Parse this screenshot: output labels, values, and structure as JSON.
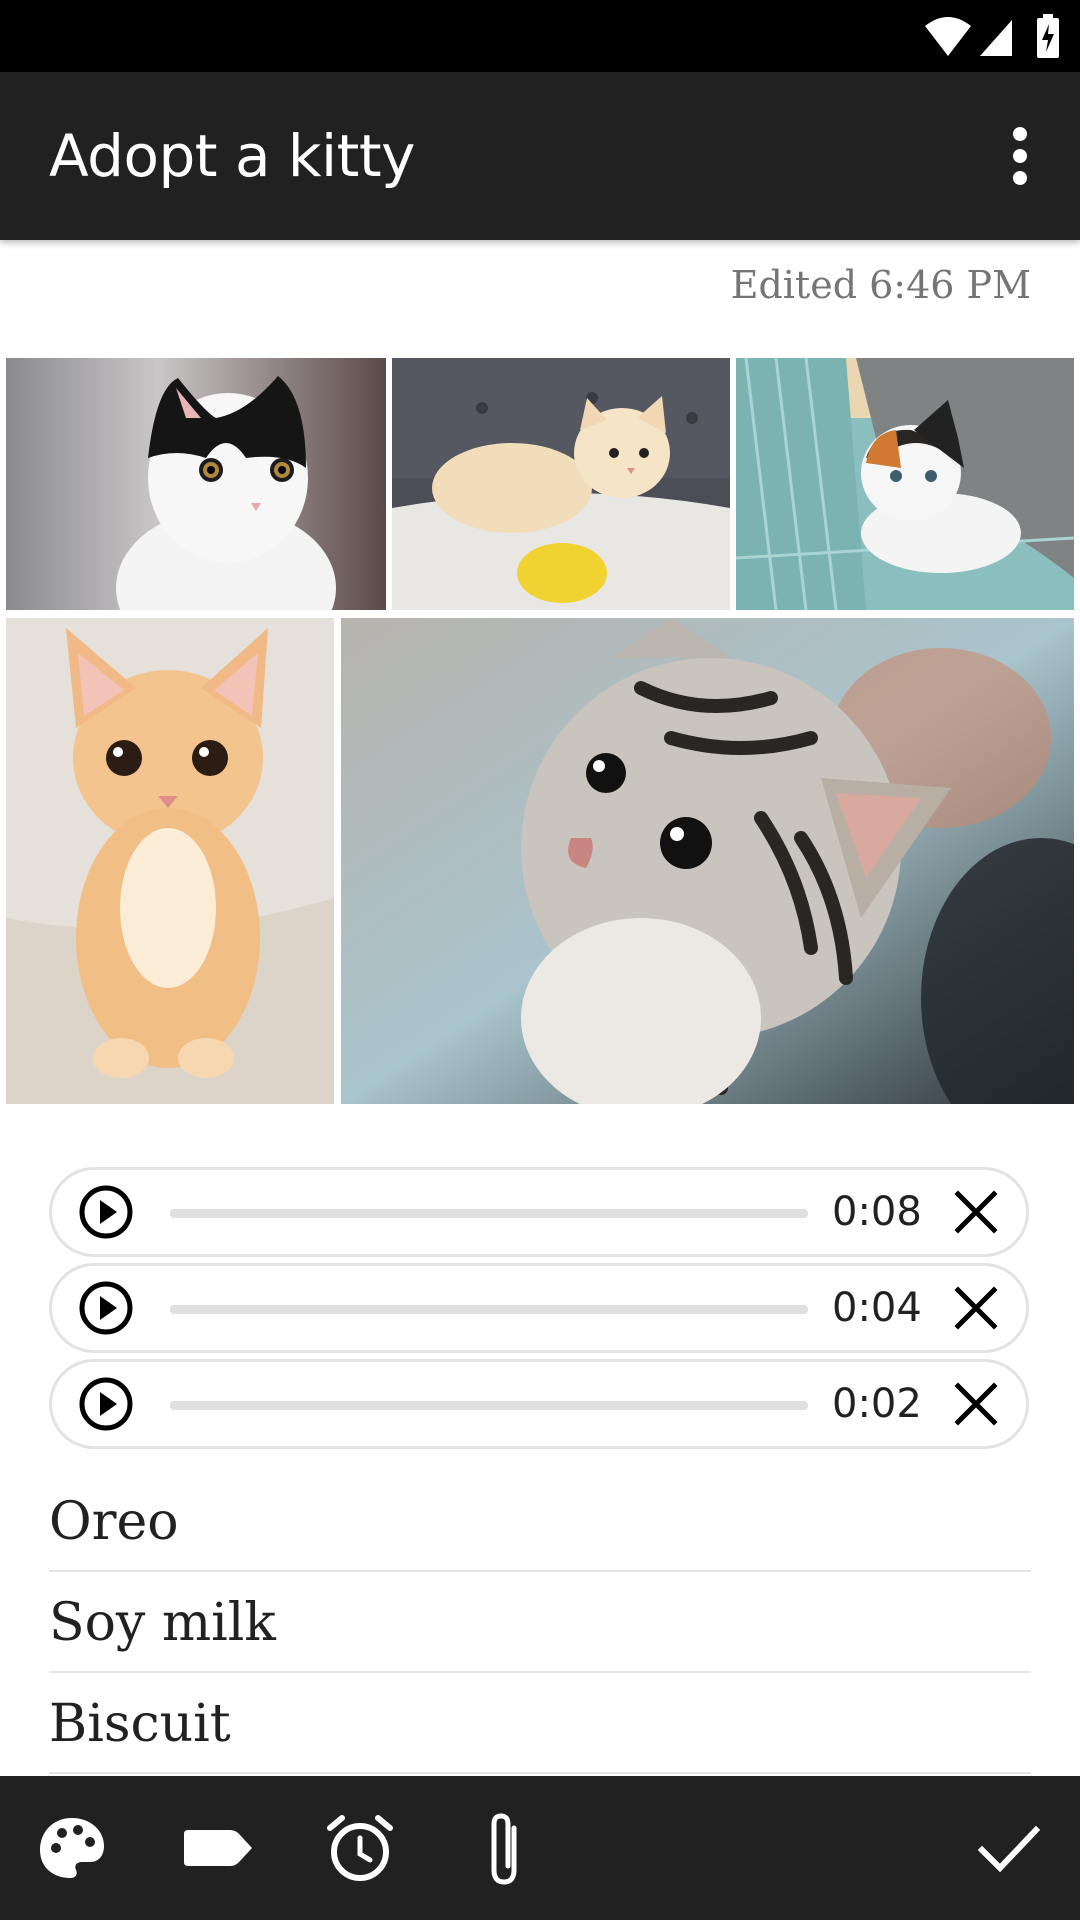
{
  "app": {
    "title": "Adopt a kitty"
  },
  "note": {
    "edited_label": "Edited 6:46 PM"
  },
  "photos": [
    {
      "name": "black-white-kitten"
    },
    {
      "name": "cream-kitten-lying"
    },
    {
      "name": "calico-kitten-blanket"
    },
    {
      "name": "orange-kitten-standing"
    },
    {
      "name": "tabby-kitten-closeup"
    }
  ],
  "audio_clips": [
    {
      "duration": "0:08"
    },
    {
      "duration": "0:04"
    },
    {
      "duration": "0:02"
    }
  ],
  "list_items": [
    {
      "text": "Oreo"
    },
    {
      "text": "Soy milk"
    },
    {
      "text": "Biscuit"
    }
  ],
  "icons": {
    "status": [
      "wifi-icon",
      "cell-signal-icon",
      "battery-icon"
    ],
    "app_bar": [
      "more-vert-icon"
    ],
    "bottom_bar": [
      "palette-icon",
      "label-icon",
      "alarm-icon",
      "attach-icon",
      "check-icon"
    ],
    "clip": [
      "play-icon",
      "close-icon"
    ]
  },
  "colors": {
    "status_bar": "#000000",
    "app_bar": "#212121",
    "bottom_bar": "#212121",
    "background": "#ffffff",
    "clip_border": "#e3e3e3",
    "track": "#e0e0e0"
  }
}
